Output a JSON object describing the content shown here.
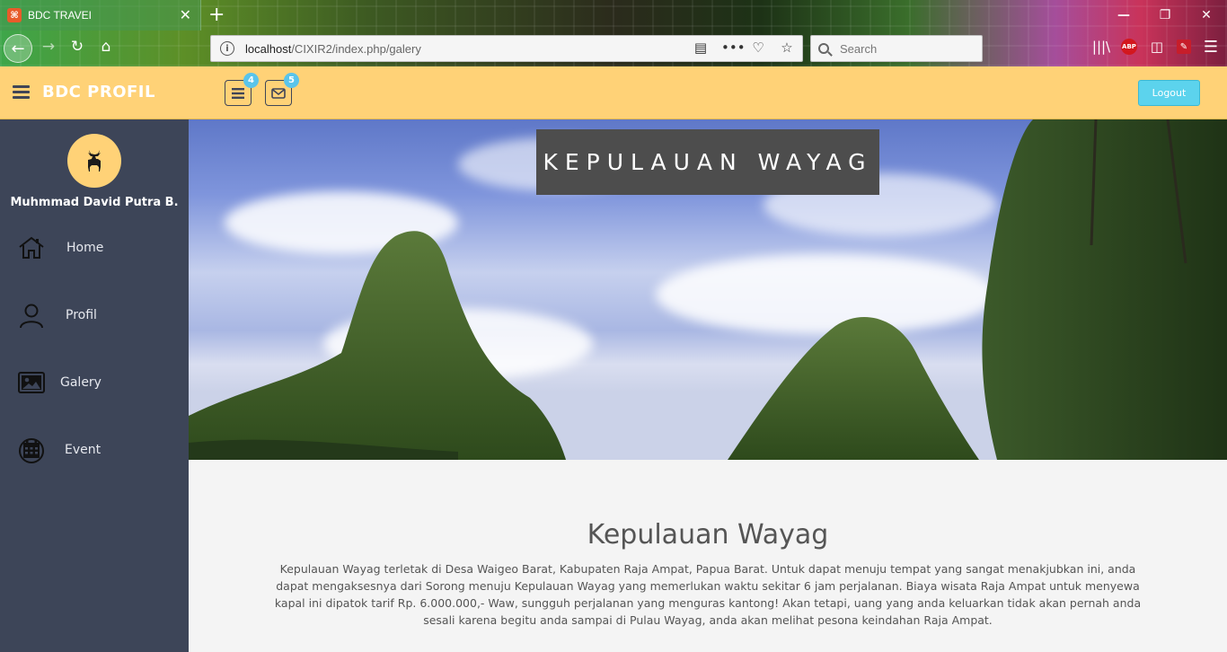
{
  "browser": {
    "tab_title": "BDC TRAVEI",
    "favicon_glyph": "⌘",
    "url_host": "localhost",
    "url_path": "/CIXIR2/index.php/galery",
    "search_placeholder": "Search",
    "abp_label": "ABP"
  },
  "header": {
    "brand": "BDC PROFIL",
    "tasks_badge": "4",
    "messages_badge": "5",
    "logout_label": "Logout",
    "background": "#ffd277",
    "logout_color": "#5cd3ed"
  },
  "sidebar": {
    "user_name": "Muhmmad David Putra B.",
    "background": "#3d4558",
    "items": [
      {
        "label": "Home",
        "icon": "home-icon"
      },
      {
        "label": "Profil",
        "icon": "user-icon"
      },
      {
        "label": "Galery",
        "icon": "image-icon"
      },
      {
        "label": "Event",
        "icon": "calendar-icon"
      }
    ]
  },
  "main": {
    "hero_title": "KEPULAUAN WAYAG",
    "section_title": "Kepulauan Wayag",
    "section_text": "Kepulauan Wayag terletak di Desa Waigeo Barat, Kabupaten Raja Ampat, Papua Barat. Untuk dapat menuju tempat yang sangat menakjubkan ini, anda dapat mengaksesnya dari Sorong menuju Kepulauan Wayag yang memerlukan waktu sekitar 6 jam perjalanan. Biaya wisata Raja Ampat untuk menyewa kapal ini dipatok tarif Rp. 6.000.000,- Waw, sungguh perjalanan yang menguras kantong! Akan tetapi, uang yang anda keluarkan tidak akan pernah anda sesali karena begitu anda sampai di Pulau Wayag, anda akan melihat pesona keindahan Raja Ampat."
  }
}
